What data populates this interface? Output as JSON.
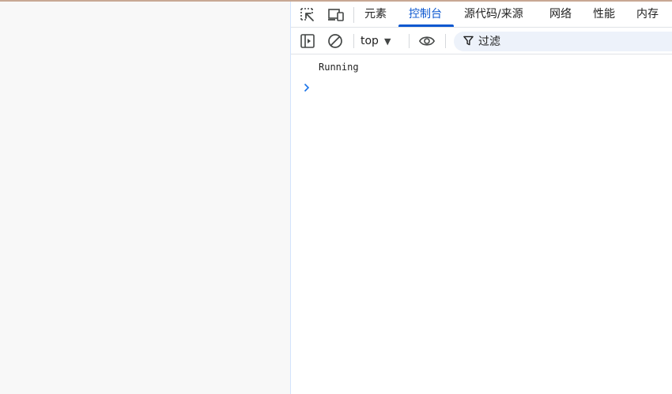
{
  "devtools": {
    "tabs": [
      {
        "label": "元素",
        "active": false
      },
      {
        "label": "控制台",
        "active": true
      },
      {
        "label": "源代码/来源",
        "active": false
      },
      {
        "label": "网络",
        "active": false
      },
      {
        "label": "性能",
        "active": false
      },
      {
        "label": "内存",
        "active": false
      }
    ],
    "toolbar": {
      "context": "top",
      "filter_placeholder": "过滤"
    },
    "console": {
      "messages": [
        "Running"
      ]
    },
    "colors": {
      "accent": "#0b57d0",
      "prompt": "#1a73e8"
    }
  }
}
